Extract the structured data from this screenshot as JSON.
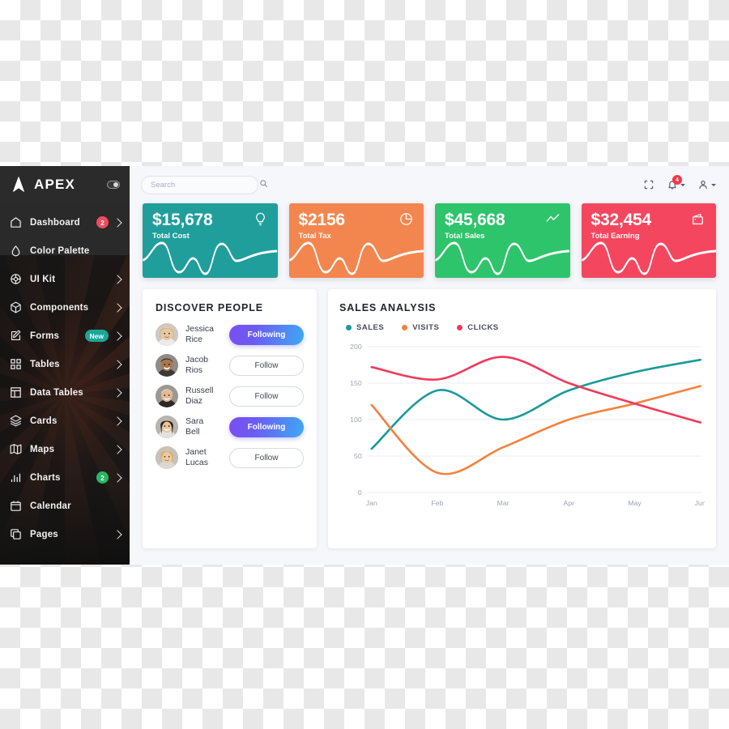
{
  "brand": {
    "name": "APEX",
    "logo_icon": "apex-logo-icon",
    "collapse_toggle_icon": "sidebar-toggle-icon"
  },
  "sidebar": {
    "items": [
      {
        "label": "Dashboard",
        "icon": "home-icon",
        "badge": "2",
        "badge_color": "#ef4b5e",
        "chevron": true
      },
      {
        "label": "Color Palette",
        "icon": "droplet-icon",
        "badge": "",
        "badge_color": "",
        "chevron": false
      },
      {
        "label": "UI Kit",
        "icon": "wheel-icon",
        "badge": "",
        "badge_color": "",
        "chevron": true
      },
      {
        "label": "Components",
        "icon": "cube-icon",
        "badge": "",
        "badge_color": "",
        "chevron": true
      },
      {
        "label": "Forms",
        "icon": "edit-square-icon",
        "badge": "New",
        "badge_color": "#1aa79a",
        "chevron": true
      },
      {
        "label": "Tables",
        "icon": "grid-icon",
        "badge": "",
        "badge_color": "",
        "chevron": true
      },
      {
        "label": "Data Tables",
        "icon": "table-icon",
        "badge": "",
        "badge_color": "",
        "chevron": true
      },
      {
        "label": "Cards",
        "icon": "layers-icon",
        "badge": "",
        "badge_color": "",
        "chevron": true
      },
      {
        "label": "Maps",
        "icon": "map-icon",
        "badge": "",
        "badge_color": "",
        "chevron": true
      },
      {
        "label": "Charts",
        "icon": "bar-chart-icon",
        "badge": "2",
        "badge_color": "#27b765",
        "chevron": true
      },
      {
        "label": "Calendar",
        "icon": "calendar-icon",
        "badge": "",
        "badge_color": "",
        "chevron": false
      },
      {
        "label": "Pages",
        "icon": "copy-icon",
        "badge": "",
        "badge_color": "",
        "chevron": true
      }
    ]
  },
  "topbar": {
    "search_placeholder": "Search",
    "search_value": "",
    "search_icon": "search-icon",
    "fullscreen_icon": "fullscreen-icon",
    "bell_icon": "bell-icon",
    "bell_count": "4",
    "user_icon": "user-icon"
  },
  "stat_cards": [
    {
      "value": "$15,678",
      "label": "Total Cost",
      "icon": "lightbulb-icon",
      "color": "#1f9e9c"
    },
    {
      "value": "$2156",
      "label": "Total Tax",
      "icon": "pie-chart-icon",
      "color": "#f3864f"
    },
    {
      "value": "$45,668",
      "label": "Total Sales",
      "icon": "trend-line-icon",
      "color": "#2ec46b"
    },
    {
      "value": "$32,454",
      "label": "Total Earning",
      "icon": "wallet-icon",
      "color": "#f4475f"
    }
  ],
  "people_panel": {
    "title": "DISCOVER PEOPLE",
    "people": [
      {
        "first": "Jessica",
        "last": "Rice",
        "action": "Following",
        "following": true,
        "avatar": "avatar-woman-blonde"
      },
      {
        "first": "Jacob",
        "last": "Rios",
        "action": "Follow",
        "following": false,
        "avatar": "avatar-man-dark"
      },
      {
        "first": "Russell",
        "last": "Diaz",
        "action": "Follow",
        "following": false,
        "avatar": "avatar-man-senior"
      },
      {
        "first": "Sara",
        "last": "Bell",
        "action": "Following",
        "following": true,
        "avatar": "avatar-woman-brunette"
      },
      {
        "first": "Janet",
        "last": "Lucas",
        "action": "Follow",
        "following": false,
        "avatar": "avatar-woman-blonde2"
      }
    ]
  },
  "chart_panel": {
    "title": "SALES ANALYSIS"
  },
  "chart_data": {
    "type": "line",
    "title": "SALES ANALYSIS",
    "xlabel": "",
    "ylabel": "",
    "x": [
      "Jan",
      "Feb",
      "Mar",
      "Apr",
      "May",
      "Jun"
    ],
    "categories": [
      "Jan",
      "Feb",
      "Mar",
      "Apr",
      "May",
      "Jun"
    ],
    "yticks": [
      0,
      50,
      100,
      150,
      200
    ],
    "ylim": [
      0,
      200
    ],
    "grid": true,
    "legend_position": "top-left",
    "series": [
      {
        "name": "SALES",
        "color": "#1b9a9a",
        "values": [
          60,
          140,
          100,
          140,
          165,
          182
        ]
      },
      {
        "name": "VISITS",
        "color": "#f5813f",
        "values": [
          120,
          27,
          62,
          100,
          122,
          146
        ]
      },
      {
        "name": "CLICKS",
        "color": "#f03a5a",
        "values": [
          172,
          155,
          186,
          150,
          122,
          96
        ]
      }
    ]
  }
}
